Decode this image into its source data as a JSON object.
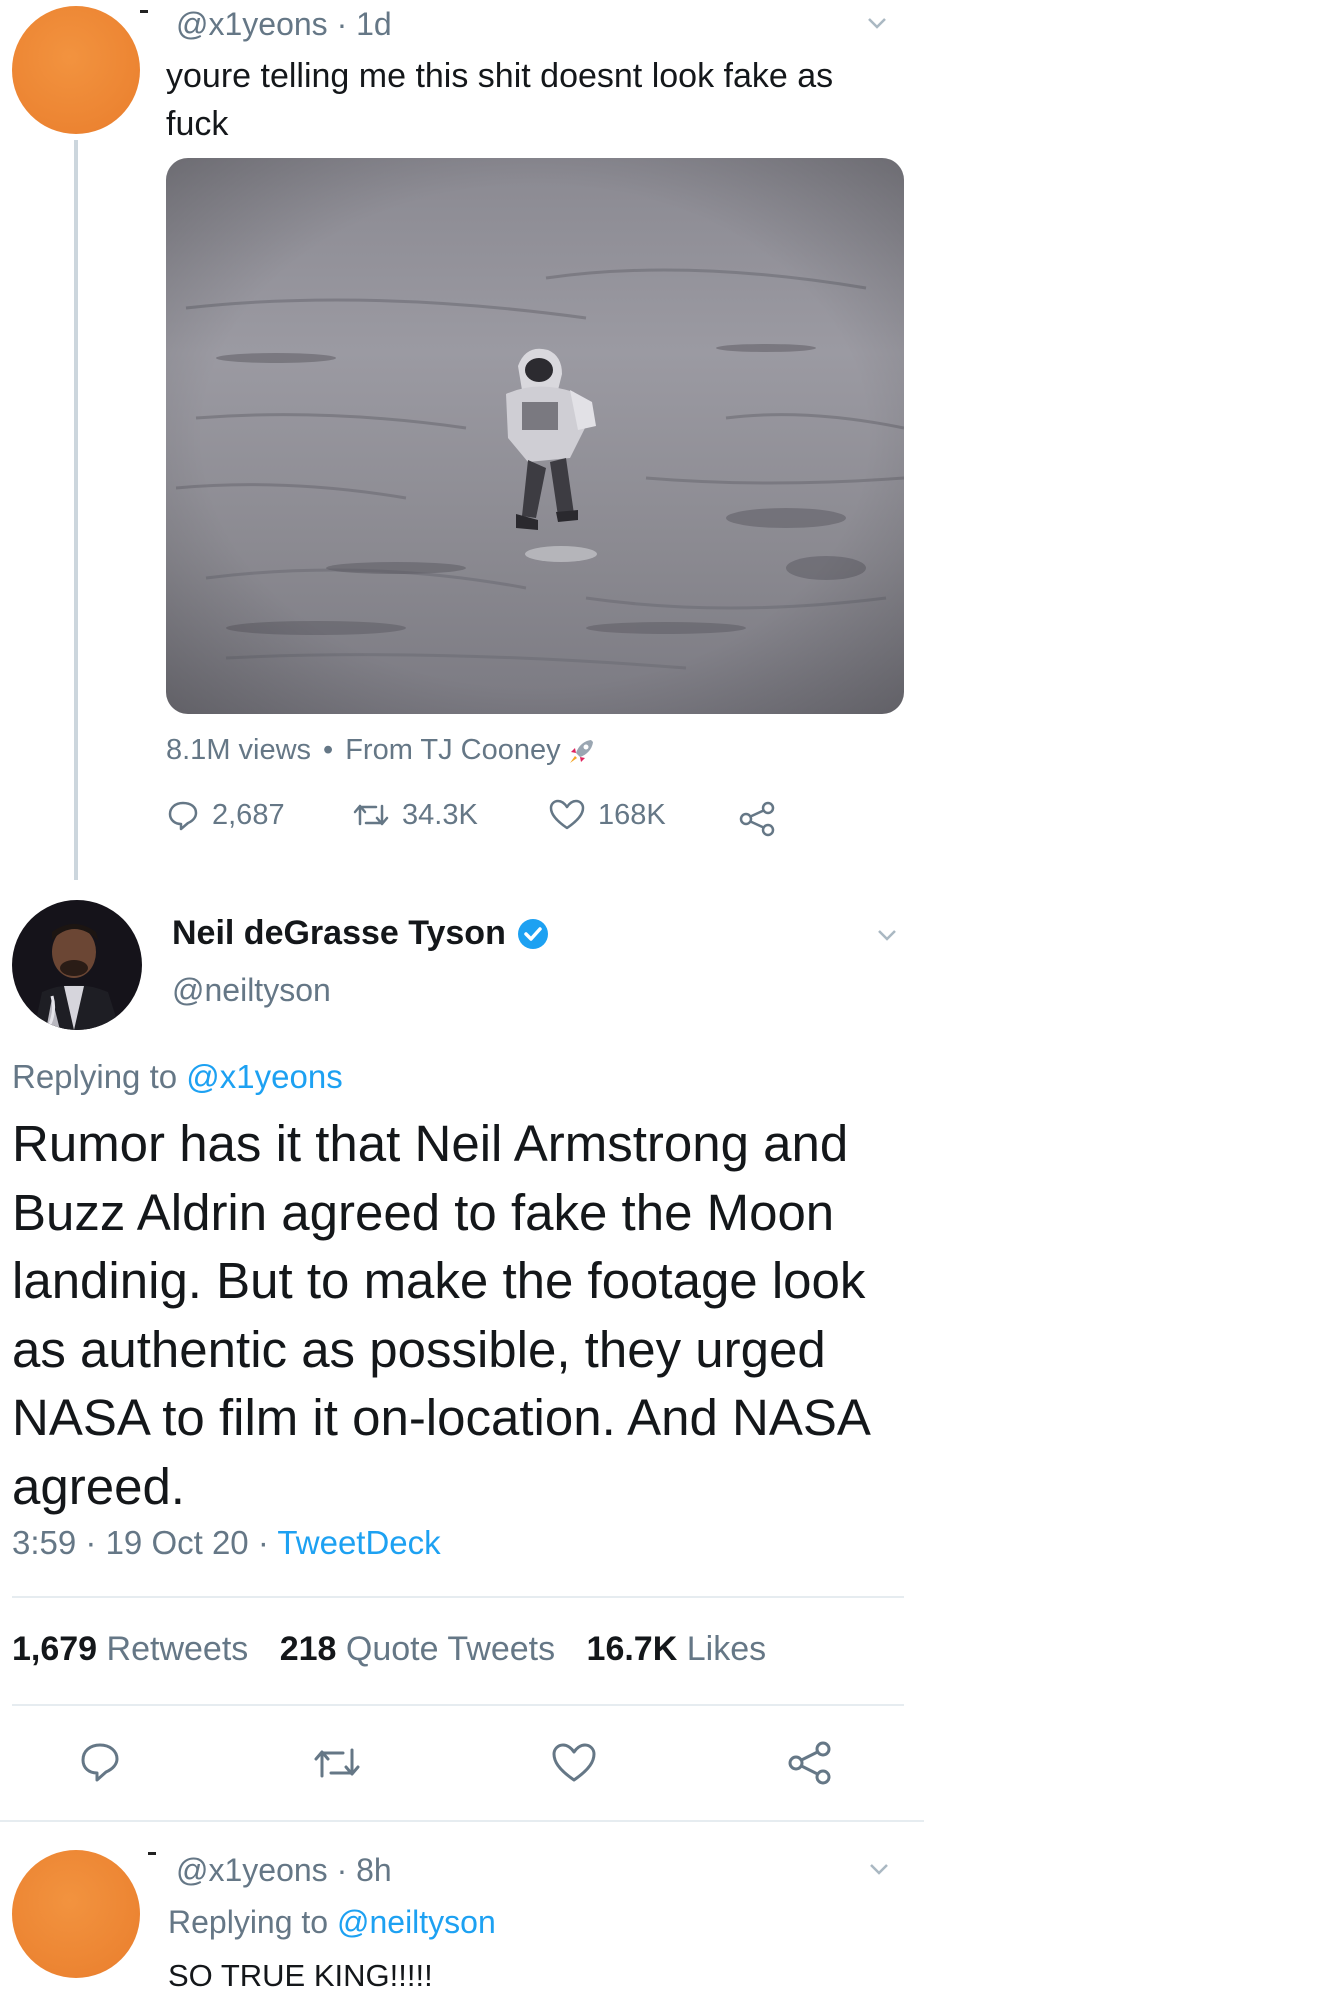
{
  "tweet1": {
    "handle": "@x1yeons",
    "time": "1d",
    "sep": "·",
    "text": "youre telling me this shit doesnt look fake as fuck",
    "media_meta_views": "8.1M views",
    "media_meta_from": "From TJ Cooney",
    "bullet": "•",
    "stats": {
      "replies": "2,687",
      "retweets": "34.3K",
      "likes": "168K"
    }
  },
  "main_tweet": {
    "name": "Neil deGrasse Tyson",
    "handle": "@neiltyson",
    "replying_prefix": "Replying to",
    "replying_to": "@x1yeons",
    "text": "Rumor has it that Neil Armstrong and Buzz Aldrin agreed to fake the Moon landinig. But to make the footage look as authentic as possible, they urged NASA to film it on-location. And NASA agreed.",
    "time": "3:59",
    "date": "19 Oct 20",
    "source": "TweetDeck",
    "sep": "·",
    "counts": {
      "retweets_num": "1,679",
      "retweets_label": "Retweets",
      "quotes_num": "218",
      "quotes_label": "Quote Tweets",
      "likes_num": "16.7K",
      "likes_label": "Likes"
    }
  },
  "tweet3": {
    "handle": "@x1yeons",
    "time": "8h",
    "sep": "·",
    "replying_prefix": "Replying to",
    "replying_to": "@neiltyson",
    "text": "SO TRUE KING!!!!!"
  },
  "icons": {
    "reply": "reply-icon",
    "retweet": "retweet-icon",
    "like": "heart-icon",
    "share": "share-icon",
    "verified": "verified-badge-icon",
    "chevron": "chevron-down-icon",
    "rocket": "rocket-icon"
  },
  "colors": {
    "accent": "#1da1f2",
    "secondary_text": "#657786",
    "avatar_orange": "#ec8432"
  }
}
